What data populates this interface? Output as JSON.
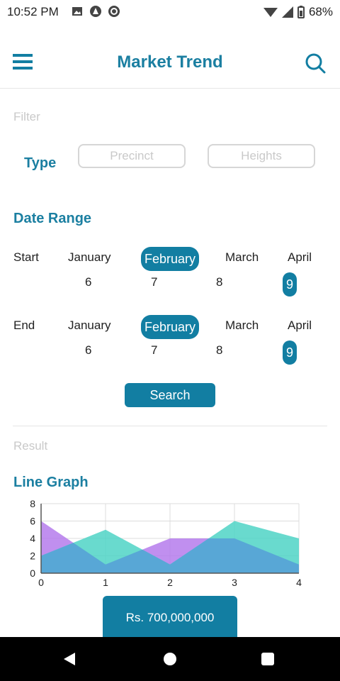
{
  "status": {
    "time": "10:52 PM",
    "battery": "68%"
  },
  "header": {
    "title": "Market Trend",
    "menu_icon": "menu-icon",
    "search_icon": "search-icon"
  },
  "filter": {
    "section_label": "Filter",
    "type_label": "Type",
    "precinct_placeholder": "Precinct",
    "heights_placeholder": "Heights"
  },
  "date_range": {
    "title": "Date Range",
    "start_label": "Start",
    "end_label": "End",
    "months": [
      "January",
      "February",
      "March",
      "April"
    ],
    "start_days": [
      "6",
      "7",
      "8",
      "9"
    ],
    "end_days": [
      "6",
      "7",
      "8",
      "9"
    ],
    "selected_month": "February",
    "selected_day": "9"
  },
  "search_button": "Search",
  "result": {
    "section_label": "Result",
    "graph_title": "Line Graph",
    "amount_button": "Rs. 700,000,000"
  },
  "chart_data": {
    "type": "area",
    "x": [
      0,
      1,
      2,
      3,
      4
    ],
    "ylim": [
      0,
      8
    ],
    "y_ticks": [
      0,
      2,
      4,
      6,
      8
    ],
    "x_ticks": [
      0,
      1,
      2,
      3,
      4
    ],
    "series": [
      {
        "values": [
          6,
          1,
          4,
          4,
          1
        ],
        "color": "#b57bec"
      },
      {
        "values": [
          2,
          5,
          1,
          6,
          4
        ],
        "color": "#4fd3c6"
      }
    ],
    "overlap_color": "#58a7d6",
    "grid": true
  }
}
